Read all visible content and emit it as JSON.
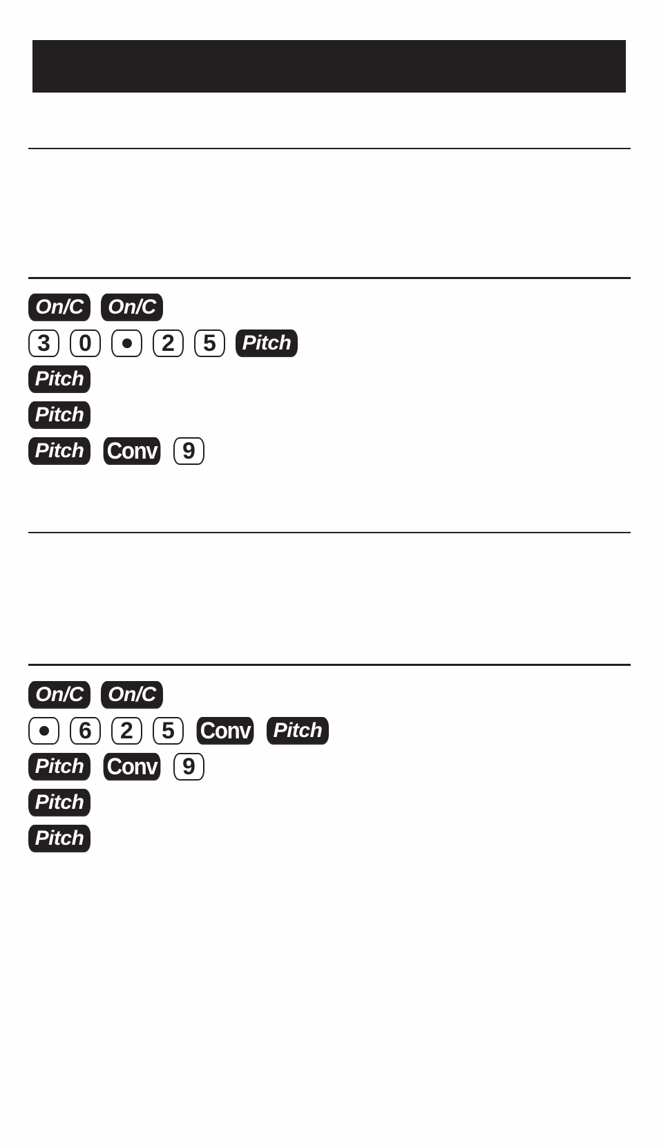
{
  "header": {
    "bar_color": "#231f20"
  },
  "example1": {
    "rows": [
      [
        {
          "label": "On/C",
          "style": "dark",
          "icon": "onc-key"
        },
        {
          "label": "On/C",
          "style": "dark",
          "icon": "onc-key"
        }
      ],
      [
        {
          "label": "3",
          "style": "light"
        },
        {
          "label": "0",
          "style": "light"
        },
        {
          "label": "•",
          "style": "light",
          "icon": "decimal-point-key"
        },
        {
          "label": "2",
          "style": "light"
        },
        {
          "label": "5",
          "style": "light"
        },
        {
          "label": "Pitch",
          "style": "dark"
        }
      ],
      [
        {
          "label": "Pitch",
          "style": "dark"
        }
      ],
      [
        {
          "label": "Pitch",
          "style": "dark"
        }
      ],
      [
        {
          "label": "Pitch",
          "style": "dark"
        },
        {
          "label": "Conv",
          "style": "dark"
        },
        {
          "label": "9",
          "style": "light"
        }
      ]
    ]
  },
  "example2": {
    "rows": [
      [
        {
          "label": "On/C",
          "style": "dark"
        },
        {
          "label": "On/C",
          "style": "dark"
        }
      ],
      [
        {
          "label": "•",
          "style": "light",
          "icon": "decimal-point-key"
        },
        {
          "label": "6",
          "style": "light"
        },
        {
          "label": "2",
          "style": "light"
        },
        {
          "label": "5",
          "style": "light"
        },
        {
          "label": "Conv",
          "style": "dark"
        },
        {
          "label": "Pitch",
          "style": "dark"
        }
      ],
      [
        {
          "label": "Pitch",
          "style": "dark"
        },
        {
          "label": "Conv",
          "style": "dark"
        },
        {
          "label": "9",
          "style": "light"
        }
      ],
      [
        {
          "label": "Pitch",
          "style": "dark"
        }
      ],
      [
        {
          "label": "Pitch",
          "style": "dark"
        }
      ]
    ]
  }
}
